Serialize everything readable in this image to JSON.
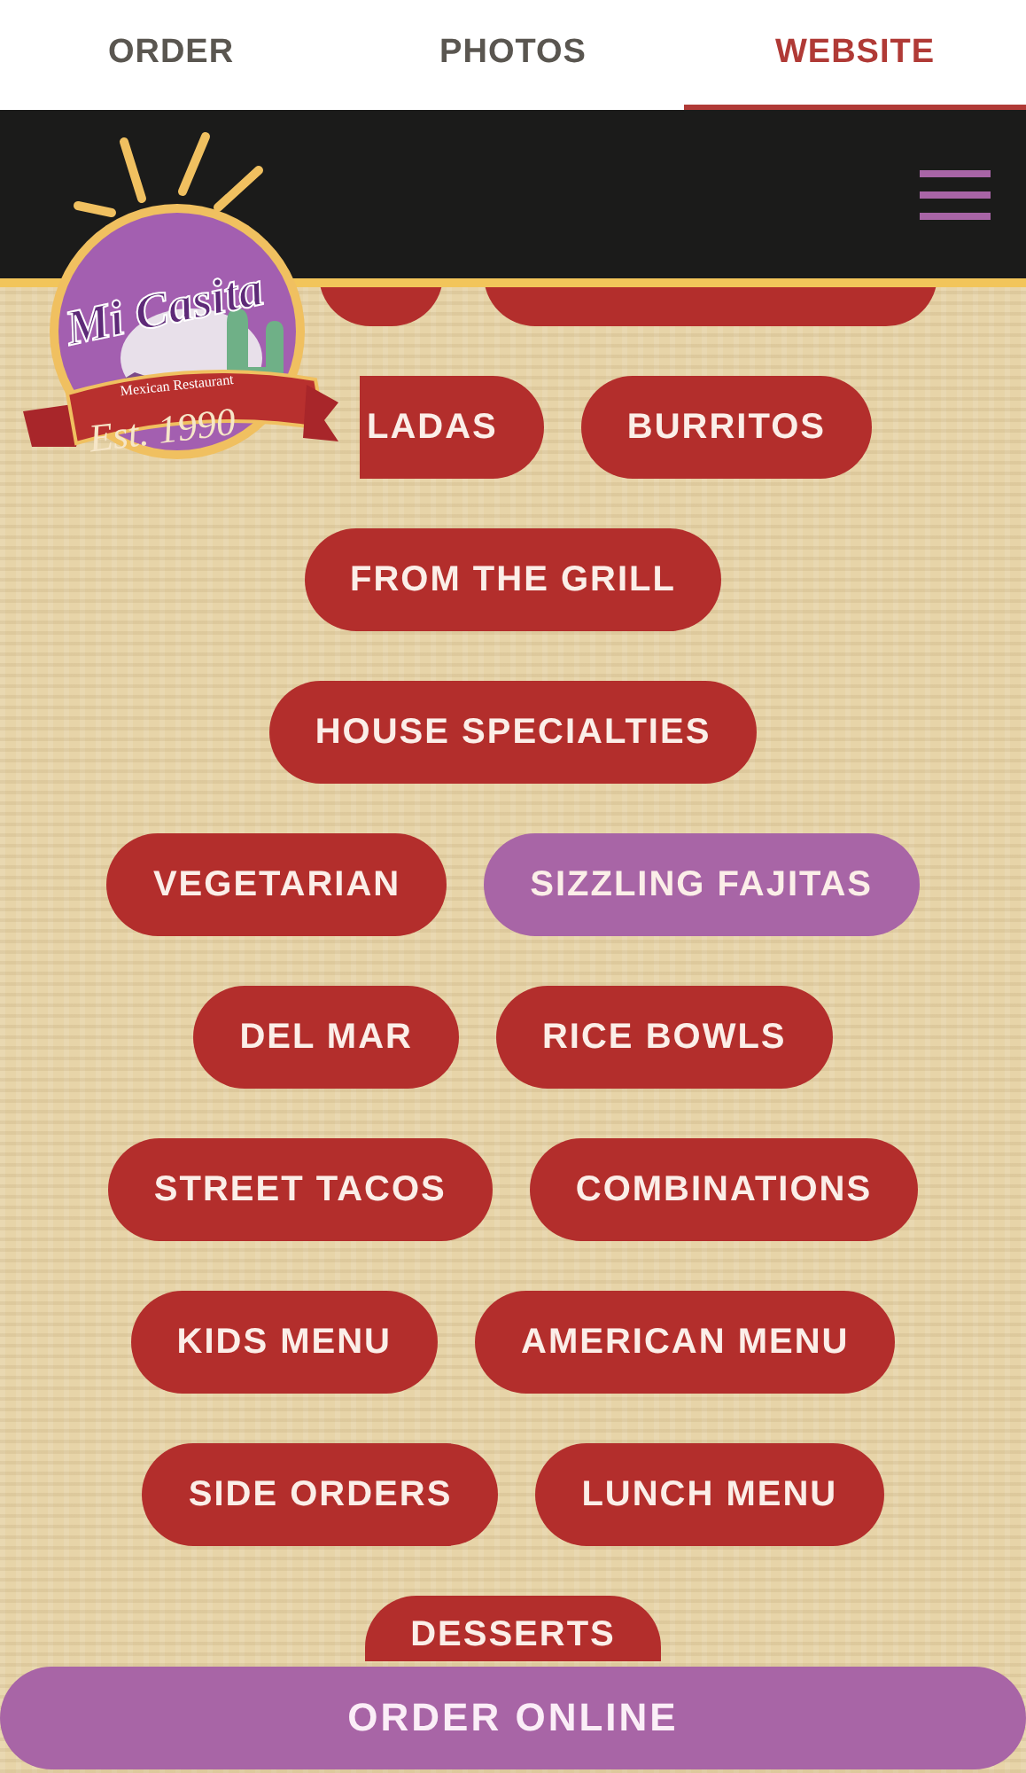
{
  "tabs": [
    {
      "label": "ORDER",
      "selected": false
    },
    {
      "label": "PHOTOS",
      "selected": false
    },
    {
      "label": "WEBSITE",
      "selected": true
    }
  ],
  "logo": {
    "name": "Mi Casita",
    "subtitle": "Mexican Restaurant",
    "established": "Est. 1990"
  },
  "menu_rows": [
    {
      "kind": "cut",
      "items": [
        {
          "label": "LADAS",
          "selected": false
        },
        {
          "label": "BURRITOS",
          "selected": false
        }
      ]
    },
    {
      "kind": "full",
      "items": [
        {
          "label": "FROM THE GRILL",
          "selected": false
        }
      ]
    },
    {
      "kind": "full",
      "items": [
        {
          "label": "HOUSE SPECIALTIES",
          "selected": false
        }
      ]
    },
    {
      "kind": "full",
      "items": [
        {
          "label": "VEGETARIAN",
          "selected": false
        },
        {
          "label": "SIZZLING FAJITAS",
          "selected": true
        }
      ]
    },
    {
      "kind": "full",
      "items": [
        {
          "label": "DEL MAR",
          "selected": false
        },
        {
          "label": "RICE BOWLS",
          "selected": false
        }
      ]
    },
    {
      "kind": "full",
      "items": [
        {
          "label": "STREET TACOS",
          "selected": false
        },
        {
          "label": "COMBINATIONS",
          "selected": false
        }
      ]
    },
    {
      "kind": "full",
      "items": [
        {
          "label": "KIDS MENU",
          "selected": false
        },
        {
          "label": "AMERICAN MENU",
          "selected": false
        }
      ]
    },
    {
      "kind": "full",
      "items": [
        {
          "label": "SIDE ORDERS",
          "selected": false
        },
        {
          "label": "LUNCH MENU",
          "selected": false
        }
      ]
    },
    {
      "kind": "covered",
      "items": [
        {
          "label": "DESSERTS",
          "selected": false
        }
      ]
    }
  ],
  "order_button": "ORDER ONLINE"
}
